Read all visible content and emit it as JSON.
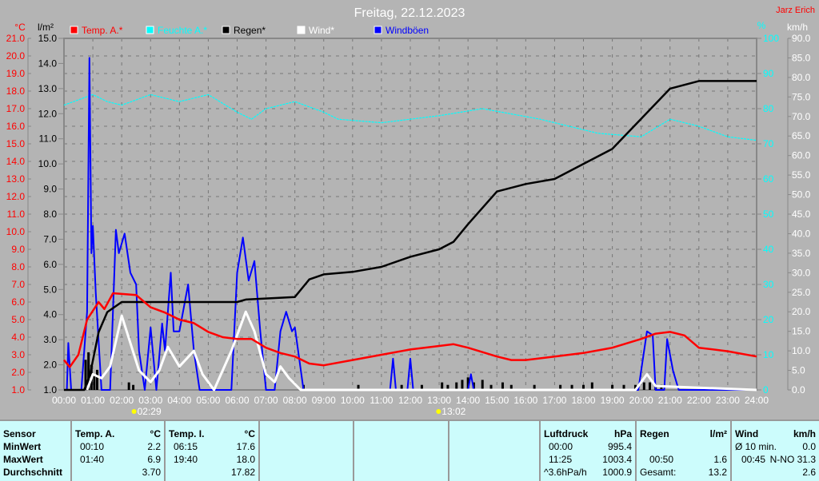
{
  "header": {
    "title": "Freitag, 22.12.2023",
    "author": "Jarz Erich"
  },
  "chart_data": {
    "type": "line",
    "title": "Freitag, 22.12.2023",
    "legend": [
      "Temp. A.*",
      "Feuchte A.*",
      "Regen*",
      "Wind*",
      "Windböen"
    ],
    "legend_colors": [
      "#ff0000",
      "#00ffff",
      "#000000",
      "#ffffff",
      "#0000ff"
    ],
    "legend_placement": "top",
    "axes": {
      "temp": {
        "unit": "°C",
        "ticks": [
          "21.0",
          "20.0",
          "19.0",
          "18.0",
          "17.0",
          "16.0",
          "15.0",
          "14.0",
          "13.0",
          "12.0",
          "11.0",
          "10.0",
          "9.0",
          "8.0",
          "7.0",
          "6.0",
          "5.0",
          "4.0",
          "3.0",
          "2.0",
          "1.0"
        ],
        "range": [
          1,
          21
        ]
      },
      "rain": {
        "unit": "l/m²",
        "ticks": [
          "15.0",
          "14.0",
          "13.0",
          "12.0",
          "11.0",
          "10.0",
          "9.0",
          "8.0",
          "7.0",
          "6.0",
          "5.0",
          "4.0",
          "3.0",
          "2.0",
          "1.0"
        ],
        "range": [
          1,
          15
        ]
      },
      "humidity": {
        "unit": "%",
        "ticks": [
          "100",
          "90",
          "80",
          "70",
          "60",
          "50",
          "40",
          "30",
          "20",
          "10",
          "0"
        ],
        "range": [
          0,
          100
        ]
      },
      "wind": {
        "unit": "km/h",
        "ticks": [
          "90.0",
          "85.0",
          "80.0",
          "75.0",
          "70.0",
          "65.0",
          "60.0",
          "55.0",
          "50.0",
          "45.0",
          "40.0",
          "35.0",
          "30.0",
          "25.0",
          "20.0",
          "15.0",
          "10.0",
          "5.0",
          "0.0"
        ],
        "range": [
          0,
          90
        ]
      },
      "x": {
        "ticks": [
          "00:00",
          "01:00",
          "02:00",
          "03:00",
          "04:00",
          "05:00",
          "06:00",
          "07:00",
          "08:00",
          "09:00",
          "10:00",
          "11:00",
          "12:00",
          "13:00",
          "14:00",
          "15:00",
          "16:00",
          "17:00",
          "18:00",
          "19:00",
          "20:00",
          "21:00",
          "22:00",
          "23:00",
          "24:00"
        ],
        "range": [
          0,
          24
        ]
      }
    },
    "sunrise": "02:29",
    "sunset": "13:02",
    "series": [
      {
        "name": "Temp. A.*",
        "axis": "temp",
        "points": [
          [
            0,
            2.7
          ],
          [
            0.2,
            2.3
          ],
          [
            0.5,
            3.0
          ],
          [
            0.8,
            5.0
          ],
          [
            1.2,
            6.0
          ],
          [
            1.4,
            5.6
          ],
          [
            1.7,
            6.5
          ],
          [
            2.5,
            6.4
          ],
          [
            3,
            5.7
          ],
          [
            3.5,
            5.4
          ],
          [
            4,
            5.0
          ],
          [
            4.5,
            4.8
          ],
          [
            5,
            4.3
          ],
          [
            5.5,
            4.0
          ],
          [
            6,
            3.9
          ],
          [
            6.5,
            3.9
          ],
          [
            7,
            3.4
          ],
          [
            7.5,
            3.1
          ],
          [
            8,
            2.9
          ],
          [
            8.5,
            2.5
          ],
          [
            9,
            2.4
          ],
          [
            10,
            2.7
          ],
          [
            11,
            3.0
          ],
          [
            12,
            3.3
          ],
          [
            13,
            3.5
          ],
          [
            13.5,
            3.6
          ],
          [
            14,
            3.4
          ],
          [
            15,
            2.9
          ],
          [
            15.5,
            2.7
          ],
          [
            16,
            2.7
          ],
          [
            17,
            2.9
          ],
          [
            18,
            3.1
          ],
          [
            19,
            3.4
          ],
          [
            20,
            3.9
          ],
          [
            20.5,
            4.2
          ],
          [
            21,
            4.3
          ],
          [
            21.5,
            4.1
          ],
          [
            22,
            3.4
          ],
          [
            23,
            3.2
          ],
          [
            24,
            2.9
          ]
        ]
      },
      {
        "name": "Feuchte A.*",
        "axis": "humidity",
        "points": [
          [
            0,
            81
          ],
          [
            1,
            84
          ],
          [
            1.5,
            82
          ],
          [
            2,
            81
          ],
          [
            3,
            84
          ],
          [
            4,
            82
          ],
          [
            5,
            84
          ],
          [
            6,
            79
          ],
          [
            6.5,
            77
          ],
          [
            7,
            80
          ],
          [
            8,
            82
          ],
          [
            9,
            79
          ],
          [
            9.5,
            77
          ],
          [
            11,
            76
          ],
          [
            12,
            77
          ],
          [
            13,
            78
          ],
          [
            14.5,
            80
          ],
          [
            16.5,
            77
          ],
          [
            18.5,
            73
          ],
          [
            20,
            72
          ],
          [
            21,
            77
          ],
          [
            22,
            75
          ],
          [
            23,
            72
          ],
          [
            24,
            71
          ]
        ]
      },
      {
        "name": "Regen*",
        "axis": "rain",
        "points": [
          [
            0,
            1
          ],
          [
            0.7,
            1
          ],
          [
            0.9,
            1.6
          ],
          [
            1.2,
            3.3
          ],
          [
            1.5,
            4.1
          ],
          [
            2,
            4.5
          ],
          [
            3,
            4.5
          ],
          [
            6,
            4.5
          ],
          [
            6.3,
            4.6
          ],
          [
            8,
            4.7
          ],
          [
            8.5,
            5.4
          ],
          [
            9,
            5.6
          ],
          [
            10,
            5.7
          ],
          [
            11,
            5.9
          ],
          [
            12,
            6.3
          ],
          [
            13,
            6.6
          ],
          [
            13.5,
            6.9
          ],
          [
            14,
            7.6
          ],
          [
            15,
            8.9
          ],
          [
            16,
            9.2
          ],
          [
            17,
            9.4
          ],
          [
            18,
            10.0
          ],
          [
            19,
            10.6
          ],
          [
            20,
            11.8
          ],
          [
            21,
            13.0
          ],
          [
            22,
            13.3
          ],
          [
            24,
            13.3
          ]
        ]
      },
      {
        "name": "Wind*",
        "axis": "wind",
        "points": [
          [
            0.8,
            0
          ],
          [
            1,
            4
          ],
          [
            1.3,
            3
          ],
          [
            1.6,
            6
          ],
          [
            2,
            19
          ],
          [
            2.3,
            12
          ],
          [
            2.6,
            5
          ],
          [
            3,
            2
          ],
          [
            3.3,
            5
          ],
          [
            3.6,
            11
          ],
          [
            4,
            6
          ],
          [
            4.5,
            10
          ],
          [
            4.8,
            4
          ],
          [
            5.2,
            0
          ],
          [
            5.8,
            10
          ],
          [
            6.3,
            20
          ],
          [
            6.6,
            15
          ],
          [
            7,
            4
          ],
          [
            7.3,
            2
          ],
          [
            7.5,
            6
          ],
          [
            7.8,
            3
          ],
          [
            8.2,
            0
          ],
          [
            19.8,
            0
          ],
          [
            20.2,
            4
          ],
          [
            20.5,
            1
          ],
          [
            24,
            0
          ]
        ]
      },
      {
        "name": "Windböen",
        "axis": "wind",
        "points": [
          [
            0,
            0
          ],
          [
            0.1,
            0
          ],
          [
            0.15,
            12
          ],
          [
            0.25,
            0
          ],
          [
            0.6,
            0
          ],
          [
            0.8,
            20
          ],
          [
            0.88,
            85
          ],
          [
            0.95,
            35
          ],
          [
            1.0,
            42
          ],
          [
            1.1,
            25
          ],
          [
            1.3,
            0
          ],
          [
            1.6,
            0
          ],
          [
            1.8,
            41
          ],
          [
            1.9,
            35
          ],
          [
            2.1,
            40
          ],
          [
            2.3,
            30
          ],
          [
            2.5,
            27
          ],
          [
            2.6,
            10
          ],
          [
            2.8,
            0
          ],
          [
            3.0,
            16
          ],
          [
            3.2,
            0
          ],
          [
            3.4,
            17
          ],
          [
            3.5,
            10
          ],
          [
            3.7,
            30
          ],
          [
            3.8,
            15
          ],
          [
            4.0,
            15
          ],
          [
            4.3,
            27
          ],
          [
            4.5,
            10
          ],
          [
            4.7,
            0
          ],
          [
            5.8,
            0
          ],
          [
            6.0,
            30
          ],
          [
            6.2,
            39
          ],
          [
            6.4,
            28
          ],
          [
            6.6,
            33
          ],
          [
            6.8,
            15
          ],
          [
            7.0,
            0
          ],
          [
            7.3,
            0
          ],
          [
            7.5,
            15
          ],
          [
            7.7,
            20
          ],
          [
            7.9,
            15
          ],
          [
            8.0,
            16
          ],
          [
            8.3,
            0
          ],
          [
            11.3,
            0
          ],
          [
            11.4,
            8
          ],
          [
            11.5,
            0
          ],
          [
            11.9,
            0
          ],
          [
            12.0,
            8
          ],
          [
            12.1,
            0
          ],
          [
            14.0,
            0
          ],
          [
            14.1,
            4
          ],
          [
            14.2,
            0
          ],
          [
            19.9,
            0
          ],
          [
            20.0,
            5
          ],
          [
            20.2,
            15
          ],
          [
            20.4,
            14
          ],
          [
            20.5,
            0
          ],
          [
            20.8,
            0
          ],
          [
            20.9,
            13
          ],
          [
            21.1,
            5
          ],
          [
            21.3,
            0
          ],
          [
            24,
            0
          ]
        ]
      }
    ],
    "rain_bars": [
      [
        0.75,
        1.2
      ],
      [
        0.85,
        1.5
      ],
      [
        0.95,
        1.0
      ],
      [
        1.05,
        0.6
      ],
      [
        1.15,
        0.8
      ],
      [
        2.25,
        0.3
      ],
      [
        2.4,
        0.2
      ],
      [
        8.3,
        0.2
      ],
      [
        10.2,
        0.2
      ],
      [
        11.7,
        0.2
      ],
      [
        12.4,
        0.2
      ],
      [
        13.1,
        0.3
      ],
      [
        13.3,
        0.2
      ],
      [
        13.6,
        0.3
      ],
      [
        13.8,
        0.4
      ],
      [
        14.0,
        0.5
      ],
      [
        14.2,
        0.3
      ],
      [
        14.5,
        0.4
      ],
      [
        14.8,
        0.2
      ],
      [
        15.2,
        0.3
      ],
      [
        15.5,
        0.2
      ],
      [
        16.3,
        0.2
      ],
      [
        17.2,
        0.2
      ],
      [
        17.6,
        0.2
      ],
      [
        18.0,
        0.2
      ],
      [
        18.3,
        0.3
      ],
      [
        19.0,
        0.2
      ],
      [
        19.4,
        0.2
      ],
      [
        19.8,
        0.2
      ],
      [
        20.1,
        0.3
      ],
      [
        20.3,
        0.3
      ],
      [
        20.5,
        0.2
      ],
      [
        20.7,
        0.2
      ]
    ]
  },
  "table": {
    "rows": [
      "Sensor",
      "MinWert",
      "MaxWert",
      "Durchschnitt"
    ],
    "temp_a": {
      "title": "Temp. A.",
      "unit": "°C",
      "min_time": "00:10",
      "min": "2.2",
      "max_time": "01:40",
      "max": "6.9",
      "avg": "3.70"
    },
    "temp_i": {
      "title": "Temp. I.",
      "unit": "°C",
      "min_time": "06:15",
      "min": "17.6",
      "max_time": "19:40",
      "max": "18.0",
      "avg": "17.82"
    },
    "pressure": {
      "title": "Luftdruck",
      "unit": "hPa",
      "r1a": "00:00",
      "r1b": "995.4",
      "r2a": "11:25",
      "r2b": "1003.4",
      "r3a": "^3.6hPa/h",
      "r3b": "1000.9"
    },
    "rain": {
      "title": "Regen",
      "unit": "l/m²",
      "r2a": "00:50",
      "r2b": "1.6",
      "r3a": "Gesamt:",
      "r3b": "13.2"
    },
    "wind": {
      "title": "Wind",
      "unit": "km/h",
      "r1a": "Ø 10 min.",
      "r1b": "0.0",
      "r2a": "00:45",
      "r2b": "N-NO 31.3",
      "r3b": "2.6"
    }
  }
}
